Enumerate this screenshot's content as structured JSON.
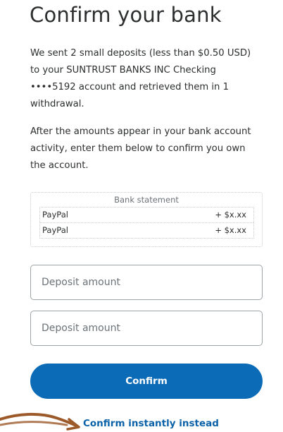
{
  "page": {
    "title": "Confirm your bank",
    "intro": "We sent 2 small deposits (less than $0.50 USD) to your SUNTRUST BANKS INC Checking ••••5192 account and retrieved them in 1 withdrawal.",
    "instructions": "After the amounts appear in your bank account activity, enter them below to confirm you own the account."
  },
  "statement": {
    "title": "Bank statement",
    "rows": [
      {
        "name": "PayPal",
        "amount": "+ $x.xx"
      },
      {
        "name": "PayPal",
        "amount": "+ $x.xx"
      }
    ]
  },
  "form": {
    "deposit1_placeholder": "Deposit amount",
    "deposit2_placeholder": "Deposit amount",
    "confirm_label": "Confirm",
    "instant_label": "Confirm instantly instead"
  },
  "colors": {
    "primary_button": "#0b6bb7",
    "link": "#0b62a8",
    "annotation_arrow": "#9c5a2a"
  }
}
